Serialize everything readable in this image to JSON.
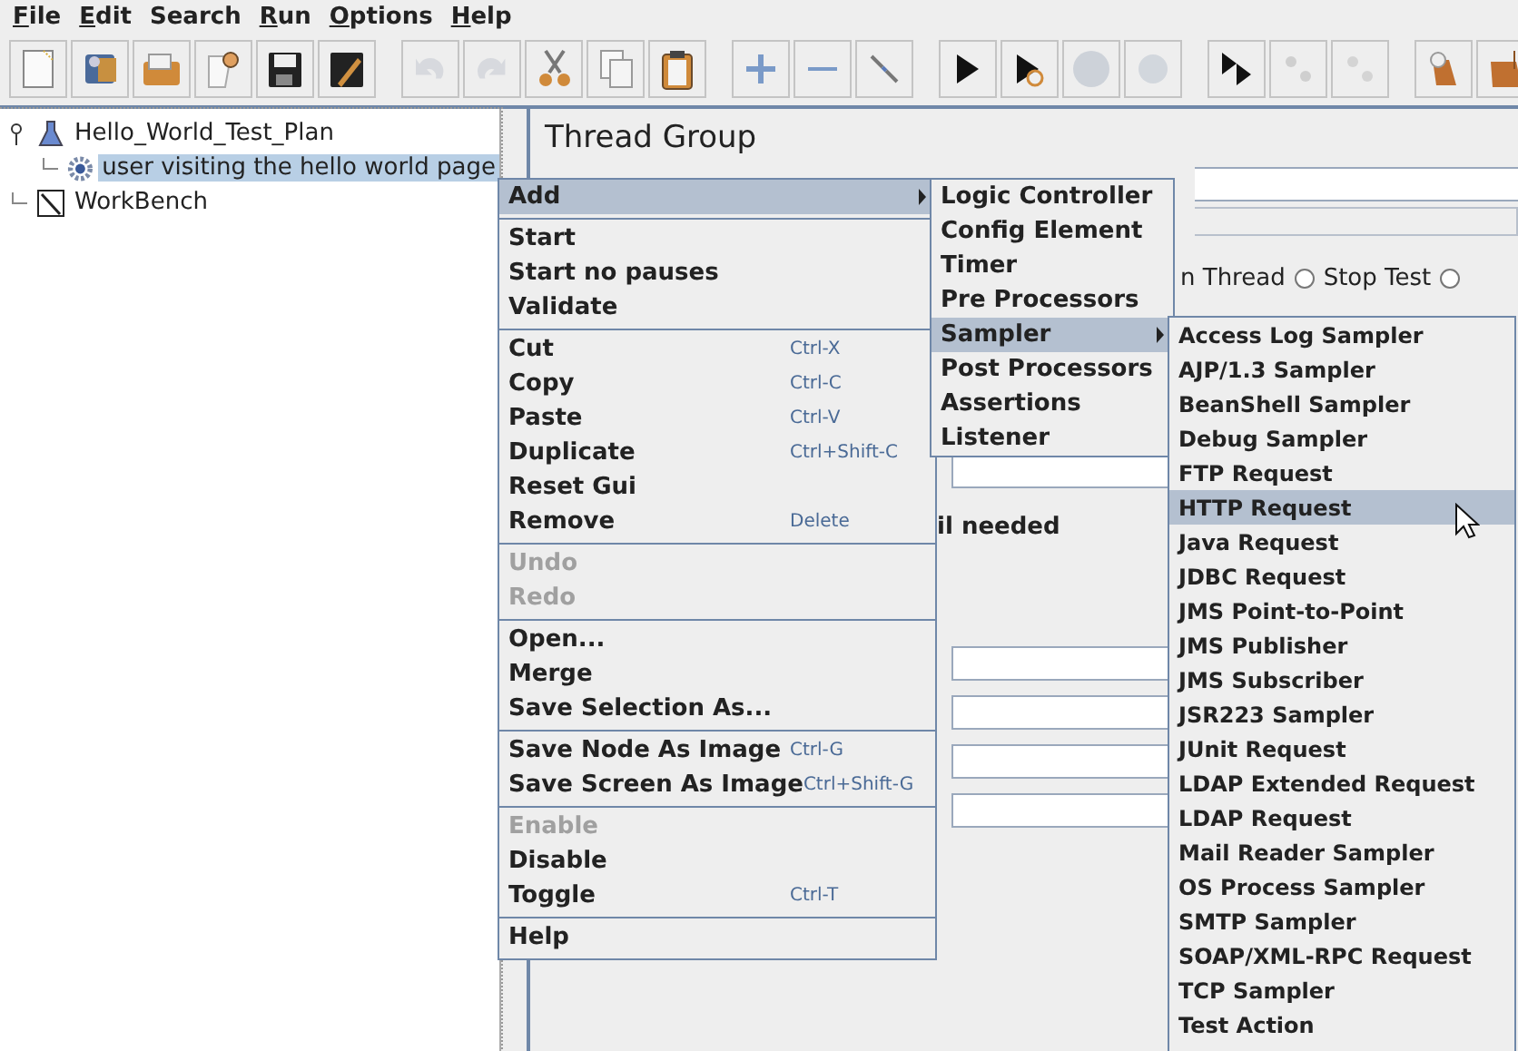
{
  "menu_bar": [
    {
      "label": "File",
      "mnemonic": true
    },
    {
      "label": "Edit",
      "mnemonic": true
    },
    {
      "label": "Search",
      "mnemonic": false
    },
    {
      "label": "Run",
      "mnemonic": true
    },
    {
      "label": "Options",
      "mnemonic": true
    },
    {
      "label": "Help",
      "mnemonic": true
    }
  ],
  "toolbar": [
    [
      {
        "kind": "new",
        "disabled": false
      },
      {
        "kind": "templates",
        "disabled": false
      },
      {
        "kind": "open",
        "disabled": false
      },
      {
        "kind": "close",
        "disabled": false
      },
      {
        "kind": "save",
        "disabled": false
      },
      {
        "kind": "save-as",
        "disabled": false
      }
    ],
    [
      {
        "kind": "undo",
        "disabled": true
      },
      {
        "kind": "redo",
        "disabled": true
      },
      {
        "kind": "cut",
        "disabled": false
      },
      {
        "kind": "copy",
        "disabled": false
      },
      {
        "kind": "paste",
        "disabled": false
      }
    ],
    [
      {
        "kind": "expand",
        "disabled": false
      },
      {
        "kind": "collapse",
        "disabled": false
      },
      {
        "kind": "toggle",
        "disabled": false
      }
    ],
    [
      {
        "kind": "start",
        "disabled": false
      },
      {
        "kind": "start-no-pauses",
        "disabled": false
      },
      {
        "kind": "stop",
        "disabled": true
      },
      {
        "kind": "shutdown",
        "disabled": true
      }
    ],
    [
      {
        "kind": "remote-start",
        "disabled": false
      },
      {
        "kind": "remote-stop",
        "disabled": true
      },
      {
        "kind": "remote-shutdown",
        "disabled": true
      }
    ],
    [
      {
        "kind": "clear",
        "disabled": false
      },
      {
        "kind": "clear-all",
        "disabled": false
      }
    ]
  ],
  "tree": [
    {
      "label": "Hello_World_Test_Plan",
      "kind": "plan",
      "selected": false,
      "expanded": true,
      "children": [
        {
          "label": "user visiting the hello world page",
          "kind": "thread-group",
          "selected": true
        }
      ]
    },
    {
      "label": "WorkBench",
      "kind": "workbench",
      "selected": false
    }
  ],
  "thread_group": {
    "title": "Thread Group",
    "radios": [
      {
        "label": "n Thread",
        "selected": false
      },
      {
        "label": "Stop Test",
        "selected": false
      }
    ],
    "note": "il needed"
  },
  "context_menu": {
    "groups": [
      [
        {
          "label": "Add",
          "disabled": false,
          "selected": true,
          "submenu": {
            "items": [
              {
                "label": "Logic Controller",
                "selected": false
              },
              {
                "label": "Config Element",
                "selected": false
              },
              {
                "label": "Timer",
                "selected": false
              },
              {
                "label": "Pre Processors",
                "selected": false
              },
              {
                "label": "Sampler",
                "selected": true,
                "submenu": {
                  "items": [
                    {
                      "label": "Access Log Sampler",
                      "selected": false
                    },
                    {
                      "label": "AJP/1.3 Sampler",
                      "selected": false
                    },
                    {
                      "label": "BeanShell Sampler",
                      "selected": false
                    },
                    {
                      "label": "Debug Sampler",
                      "selected": false
                    },
                    {
                      "label": "FTP Request",
                      "selected": false
                    },
                    {
                      "label": "HTTP Request",
                      "selected": true
                    },
                    {
                      "label": "Java Request",
                      "selected": false
                    },
                    {
                      "label": "JDBC Request",
                      "selected": false
                    },
                    {
                      "label": "JMS Point-to-Point",
                      "selected": false
                    },
                    {
                      "label": "JMS Publisher",
                      "selected": false
                    },
                    {
                      "label": "JMS Subscriber",
                      "selected": false
                    },
                    {
                      "label": "JSR223 Sampler",
                      "selected": false
                    },
                    {
                      "label": "JUnit Request",
                      "selected": false
                    },
                    {
                      "label": "LDAP Extended Request",
                      "selected": false
                    },
                    {
                      "label": "LDAP Request",
                      "selected": false
                    },
                    {
                      "label": "Mail Reader Sampler",
                      "selected": false
                    },
                    {
                      "label": "OS Process Sampler",
                      "selected": false
                    },
                    {
                      "label": "SMTP Sampler",
                      "selected": false
                    },
                    {
                      "label": "SOAP/XML-RPC Request",
                      "selected": false
                    },
                    {
                      "label": "TCP Sampler",
                      "selected": false
                    },
                    {
                      "label": "Test Action",
                      "selected": false
                    }
                  ]
                }
              },
              {
                "label": "Post Processors",
                "selected": false
              },
              {
                "label": "Assertions",
                "selected": false
              },
              {
                "label": "Listener",
                "selected": false
              }
            ]
          }
        }
      ],
      [
        {
          "label": "Start",
          "disabled": false,
          "selected": false
        },
        {
          "label": "Start no pauses",
          "disabled": false,
          "selected": false
        },
        {
          "label": "Validate",
          "disabled": false,
          "selected": false
        }
      ],
      [
        {
          "label": "Cut",
          "shortcut": "Ctrl-X",
          "disabled": false,
          "selected": false
        },
        {
          "label": "Copy",
          "shortcut": "Ctrl-C",
          "disabled": false,
          "selected": false
        },
        {
          "label": "Paste",
          "shortcut": "Ctrl-V",
          "disabled": false,
          "selected": false
        },
        {
          "label": "Duplicate",
          "shortcut": "Ctrl+Shift-C",
          "disabled": false,
          "selected": false
        },
        {
          "label": "Reset Gui",
          "disabled": false,
          "selected": false
        },
        {
          "label": "Remove",
          "shortcut": "Delete",
          "disabled": false,
          "selected": false
        }
      ],
      [
        {
          "label": "Undo",
          "disabled": true,
          "selected": false
        },
        {
          "label": "Redo",
          "disabled": true,
          "selected": false
        }
      ],
      [
        {
          "label": "Open...",
          "disabled": false,
          "selected": false
        },
        {
          "label": "Merge",
          "disabled": false,
          "selected": false
        },
        {
          "label": "Save Selection As...",
          "disabled": false,
          "selected": false
        }
      ],
      [
        {
          "label": "Save Node As Image",
          "shortcut": "Ctrl-G",
          "disabled": false,
          "selected": false
        },
        {
          "label": "Save Screen As Image",
          "shortcut": "Ctrl+Shift-G",
          "disabled": false,
          "selected": false
        }
      ],
      [
        {
          "label": "Enable",
          "disabled": true,
          "selected": false
        },
        {
          "label": "Disable",
          "disabled": false,
          "selected": false
        },
        {
          "label": "Toggle",
          "shortcut": "Ctrl-T",
          "disabled": false,
          "selected": false
        }
      ],
      [
        {
          "label": "Help",
          "disabled": false,
          "selected": false
        }
      ]
    ]
  }
}
